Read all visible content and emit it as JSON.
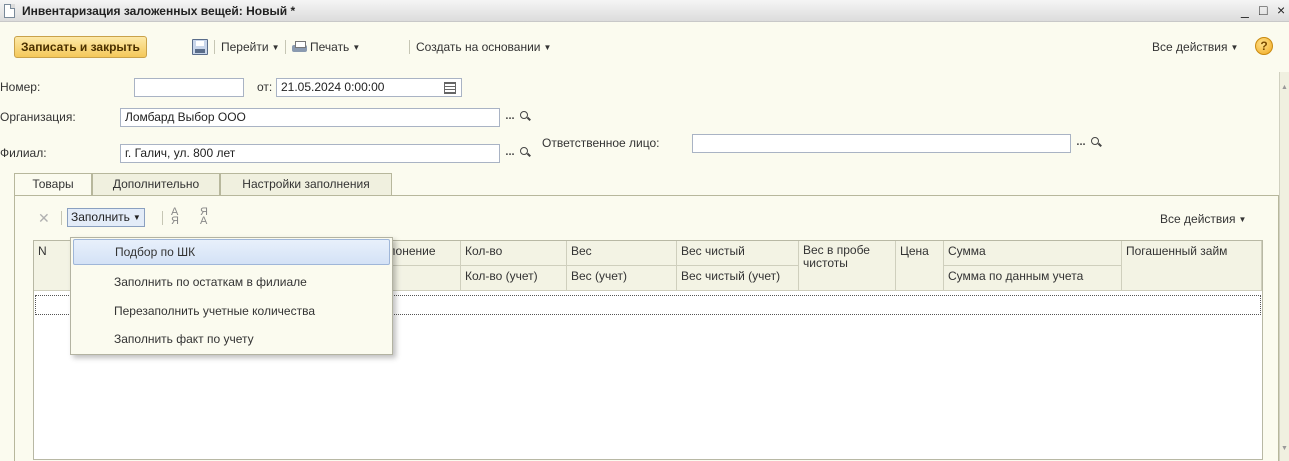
{
  "window": {
    "title": "Инвентаризация заложенных вещей: Новый *",
    "minimize": "_",
    "maximize": "□",
    "close": "×"
  },
  "toolbar": {
    "save_close_label": "Записать и закрыть",
    "goto_label": "Перейти",
    "print_label": "Печать",
    "create_based_label": "Создать на основании",
    "all_actions_label": "Все действия",
    "help_label": "?"
  },
  "form": {
    "number_label": "Номер:",
    "number_value": "",
    "date_label": "от:",
    "date_value": "21.05.2024  0:00:00",
    "organization_label": "Организация:",
    "organization_value": "Ломбард Выбор ООО",
    "branch_label": "Филиал:",
    "branch_value": "г. Галич, ул. 800 лет",
    "responsible_label": "Ответственное лицо:",
    "responsible_value": "",
    "select_dots": "..."
  },
  "tabs": [
    {
      "label": "Товары"
    },
    {
      "label": "Дополнительно"
    },
    {
      "label": "Настройки заполнения"
    }
  ],
  "table_toolbar": {
    "fill_label": "Заполнить",
    "all_actions_label": "Все действия",
    "sort_asc_label": "А Я",
    "sort_desc_label": "Я А"
  },
  "table": {
    "headers": {
      "n": "N",
      "deviation": "клонение",
      "qty": "Кол-во",
      "weight": "Вес",
      "net_weight": "Вес чистый",
      "purity_weight": "Вес в пробе чистоты",
      "price": "Цена",
      "sum": "Сумма",
      "repaid_loan": "Погашенный займ",
      "qty_acc": "Кол-во (учет)",
      "weight_acc": "Вес (учет)",
      "net_weight_acc": "Вес чистый (учет)",
      "sum_acc": "Сумма по данным учета"
    }
  },
  "fill_menu": {
    "items": [
      {
        "label": "Подбор по ШК"
      },
      {
        "label": "Заполнить по остаткам в филиале"
      },
      {
        "label": "Перезаполнить учетные количества"
      },
      {
        "label": "Заполнить факт по учету"
      }
    ]
  },
  "icons": [
    "document-icon",
    "save-icon",
    "printer-icon",
    "help-icon",
    "delete-icon",
    "sort-asc-icon",
    "sort-desc-icon",
    "calendar-icon",
    "search-icon"
  ],
  "colors": {
    "primary_button": "#f4c85a",
    "background": "#fbfbef",
    "menu_highlight": "#d4e2f6"
  }
}
